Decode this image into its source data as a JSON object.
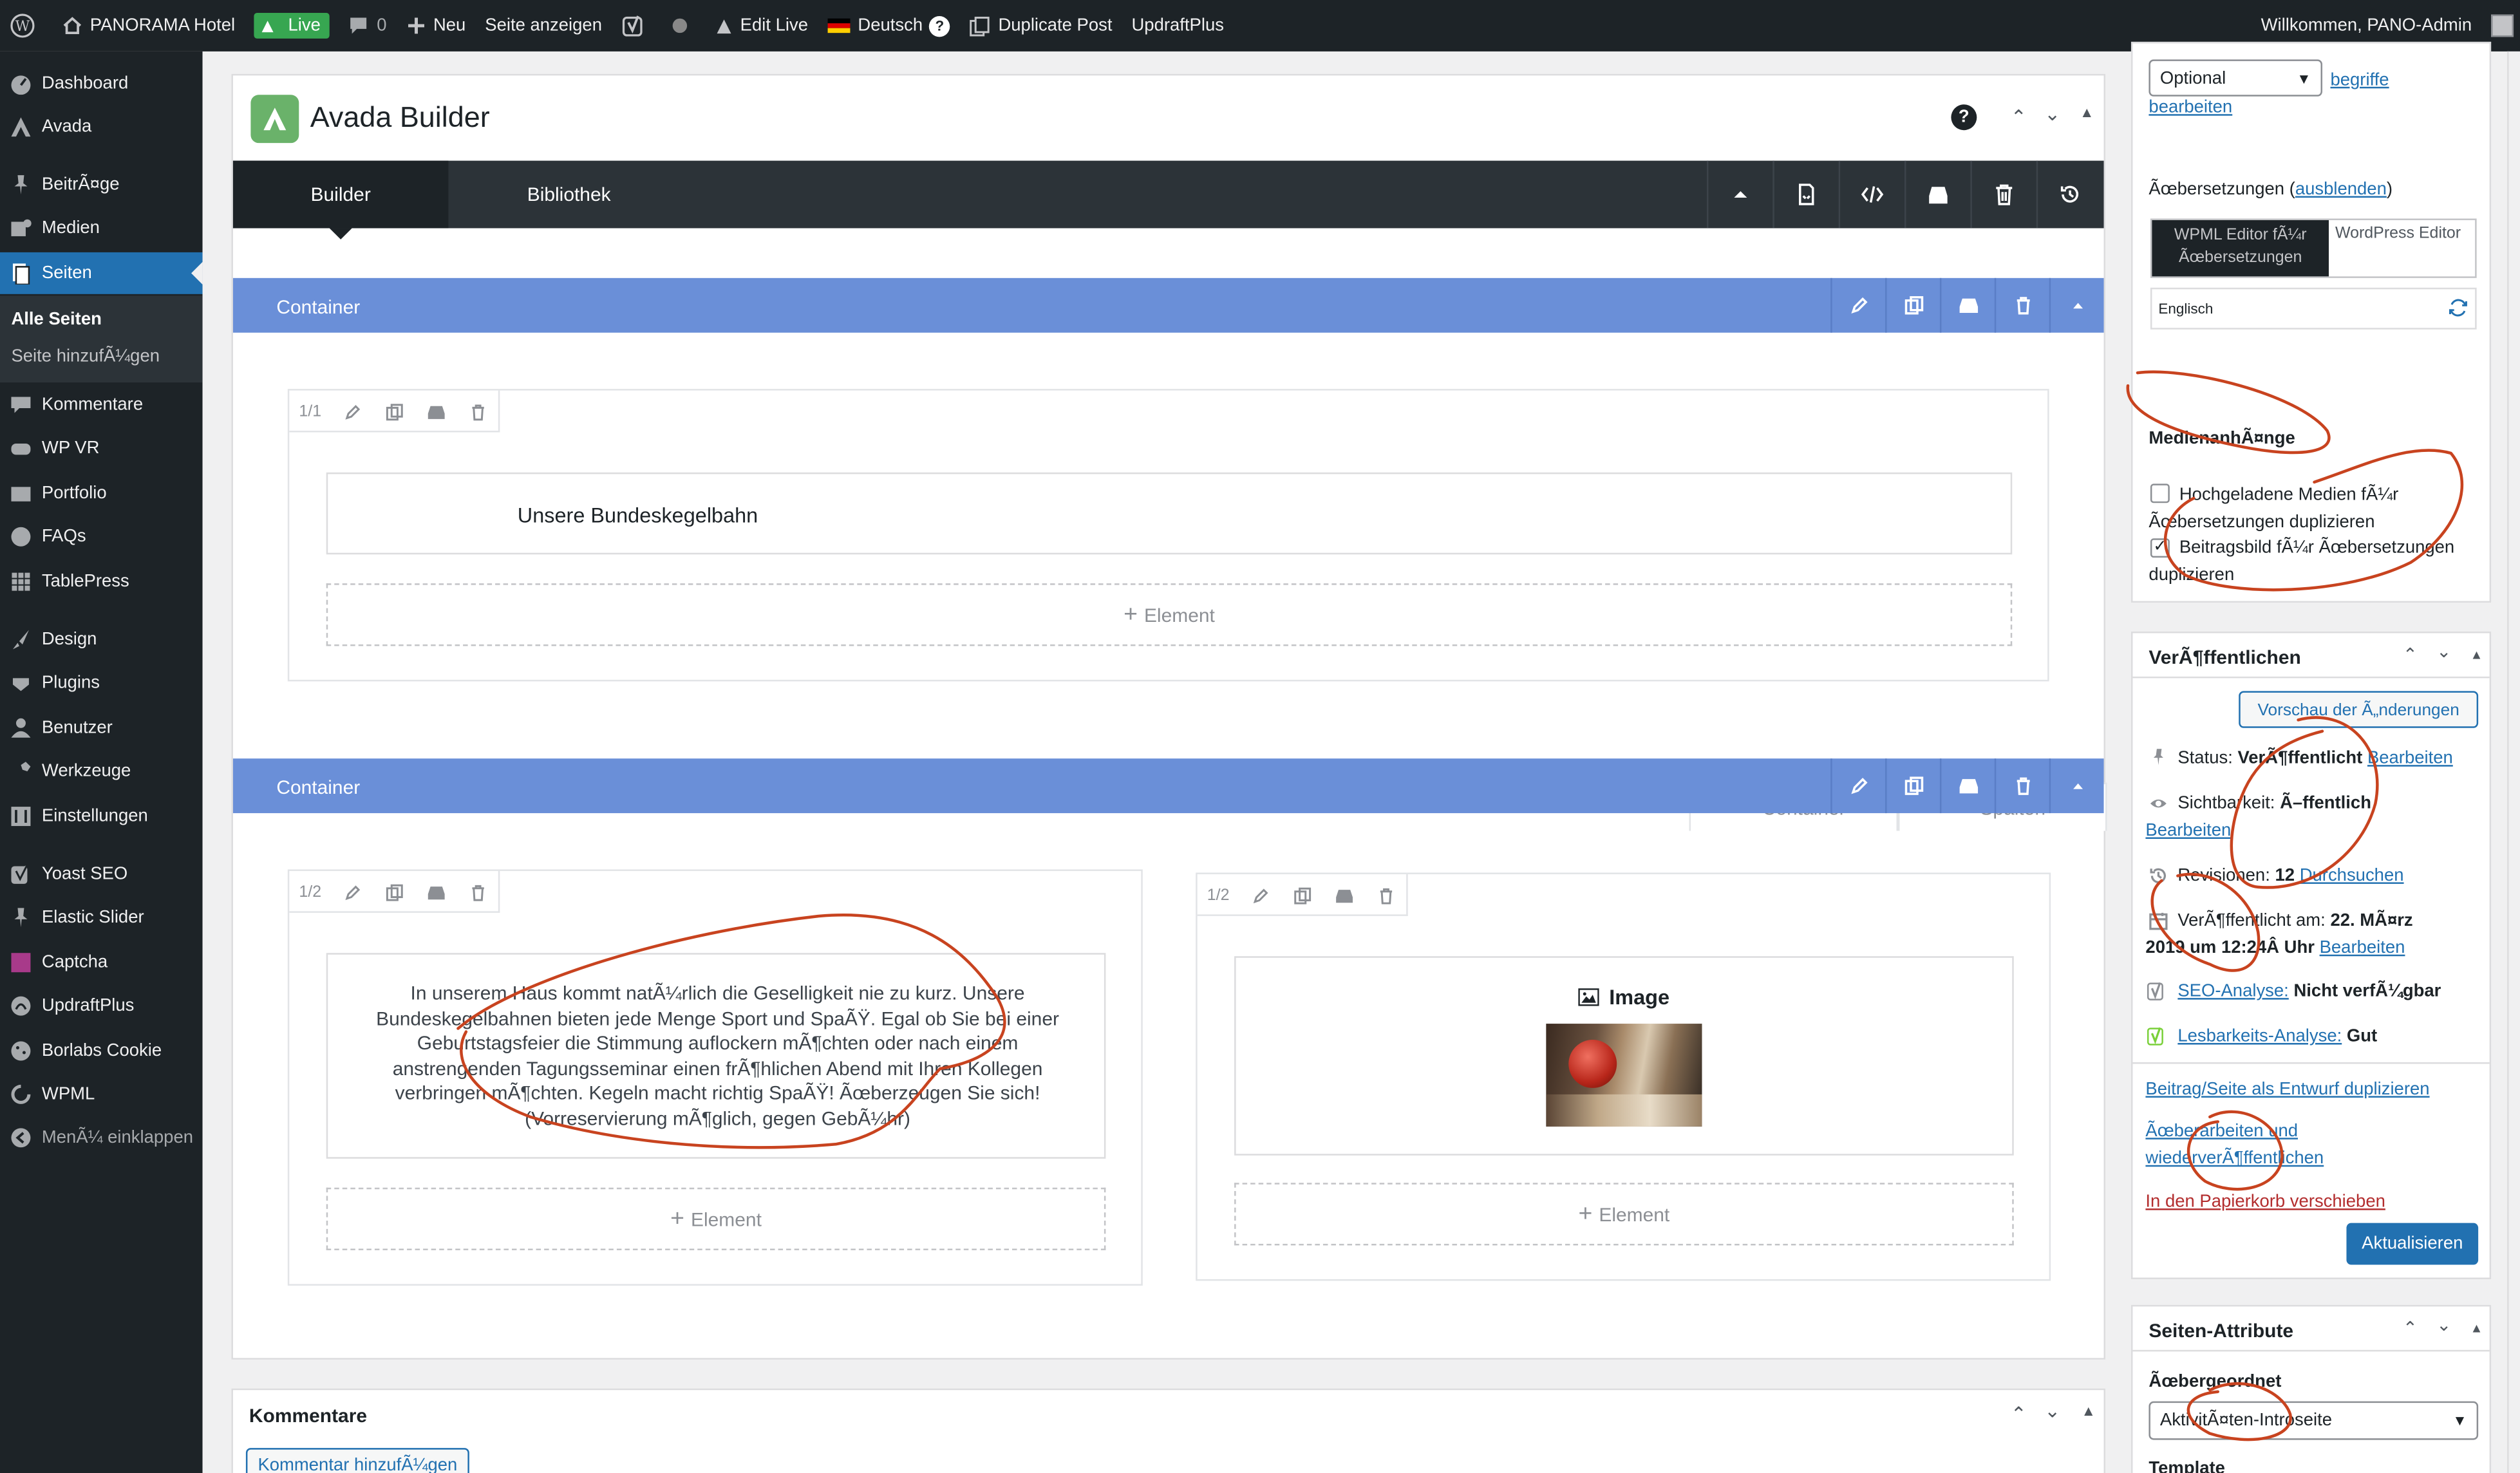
{
  "adminbar": {
    "site_name": "PANORAMA Hotel",
    "live_label": "Live",
    "comments_count": "0",
    "new_label": "Neu",
    "view_page_label": "Seite anzeigen",
    "edit_live_label": "Edit Live",
    "language_label": "Deutsch",
    "duplicate_post_label": "Duplicate Post",
    "updraftplus_label": "UpdraftPlus",
    "greeting": "Willkommen, PANO-Admin"
  },
  "sidebar": {
    "items": [
      {
        "label": "Dashboard",
        "icon": "dashboard-icon"
      },
      {
        "label": "Avada",
        "icon": "avada-icon"
      },
      {
        "label": "BeitrÃ¤ge",
        "icon": "pin-icon"
      },
      {
        "label": "Medien",
        "icon": "media-icon"
      },
      {
        "label": "Seiten",
        "icon": "pages-icon"
      },
      {
        "label": "Kommentare",
        "icon": "comments-icon"
      },
      {
        "label": "WP VR",
        "icon": "vr-icon"
      },
      {
        "label": "Portfolio",
        "icon": "portfolio-icon"
      },
      {
        "label": "FAQs",
        "icon": "faq-icon"
      },
      {
        "label": "TablePress",
        "icon": "table-icon"
      },
      {
        "label": "Design",
        "icon": "brush-icon"
      },
      {
        "label": "Plugins",
        "icon": "plugin-icon"
      },
      {
        "label": "Benutzer",
        "icon": "users-icon"
      },
      {
        "label": "Werkzeuge",
        "icon": "tools-icon"
      },
      {
        "label": "Einstellungen",
        "icon": "settings-icon"
      },
      {
        "label": "Yoast SEO",
        "icon": "yoast-icon"
      },
      {
        "label": "Elastic Slider",
        "icon": "pin-icon"
      },
      {
        "label": "Captcha",
        "icon": "captcha-icon"
      },
      {
        "label": "UpdraftPlus",
        "icon": "updraft-icon"
      },
      {
        "label": "Borlabs Cookie",
        "icon": "cookie-icon"
      },
      {
        "label": "WPML",
        "icon": "wpml-icon"
      }
    ],
    "submenu": [
      "Alle Seiten",
      "Seite hinzufÃ¼gen"
    ],
    "collapse_label": "MenÃ¼ einklappen"
  },
  "builder": {
    "title": "Avada Builder",
    "tabs": [
      "Builder",
      "Bibliothek"
    ],
    "containers": [
      {
        "label": "Container",
        "columns": [
          {
            "size": "1/1",
            "element_text": "Unsere Bundeskegelbahn",
            "add_label": "Element"
          }
        ]
      },
      {
        "label": "Container",
        "columns": [
          {
            "size": "1/2",
            "element_text": "In unserem Haus kommt natÃ¼rlich die Geselligkeit nie zu kurz. Unsere Bundeskegelbahnen bieten jede Menge Sport und SpaÃŸ. Egal ob Sie bei einer Geburtstagsfeier die Stimmung auflockern mÃ¶chten oder nach einem anstrengenden Tagungsseminar einen frÃ¶hlichen Abend mit Ihren Kollegen verbringen mÃ¶chten. Kegeln macht richtig SpaÃŸ! Ãœberzeugen Sie sich! (Vorreservierung mÃ¶glich, gegen GebÃ¼hr)",
            "add_label": "Element"
          },
          {
            "size": "1/2",
            "element_text": "Image",
            "add_label": "Element"
          }
        ]
      }
    ],
    "add_container_label": "Container",
    "add_columns_label": "Spalten"
  },
  "comments": {
    "title": "Kommentare",
    "add_button": "Kommentar hinzufÃ¼gen"
  },
  "right": {
    "optional_select": "Optional",
    "terms_link": "begriffe bearbeiten",
    "translations_label": "Ãœbersetzungen (",
    "translations_hide": "ausblenden",
    "translations_close": ")",
    "wpml_editor": "WPML Editor fÃ¼r Ãœbersetzungen",
    "wp_editor": "WordPress Editor",
    "language": "Englisch",
    "media_title": "MedienanhÃ¤nge",
    "media_opt1": "Hochgeladene Medien fÃ¼r Ãœbersetzungen duplizieren",
    "media_opt2": "Beitragsbild fÃ¼r Ãœbersetzungen duplizieren",
    "publish": {
      "title": "VerÃ¶ffentlichen",
      "preview": "Vorschau der Ã„nderungen",
      "status_label": "Status:",
      "status_value": "VerÃ¶ffentlicht",
      "edit": "Bearbeiten",
      "visibility_label": "Sichtbarkeit:",
      "visibility_value": "Ã–ffentlich",
      "revisions_label": "Revisionen:",
      "revisions_value": "12",
      "revisions_link": "Durchsuchen",
      "published_label": "VerÃ¶ffentlicht am:",
      "published_value_1": "22. MÃ¤rz",
      "published_value_2": "2019 um 12:24Â Uhr",
      "seo_link": "SEO-Analyse:",
      "seo_value": "Nicht verfÃ¼gbar",
      "read_link": "Lesbarkeits-Analyse:",
      "read_value": "Gut",
      "duplicate_draft": "Beitrag/Seite als Entwurf duplizieren",
      "rework_1": "Ãœberarbeiten und",
      "rework_2": "wiederverÃ¶ffentlichen",
      "trash": "In den Papierkorb verschieben",
      "update": "Aktualisieren"
    },
    "attributes": {
      "title": "Seiten-Attribute",
      "parent_label": "Ãœbergeordnet",
      "parent_value": "AktivitÃ¤ten-Introseite",
      "template_label": "Template"
    }
  },
  "colors": {
    "admin_dark": "#1d2327",
    "wp_blue": "#2271b1",
    "container_blue": "#6a8fd8",
    "annotation_red": "#c8431f"
  }
}
